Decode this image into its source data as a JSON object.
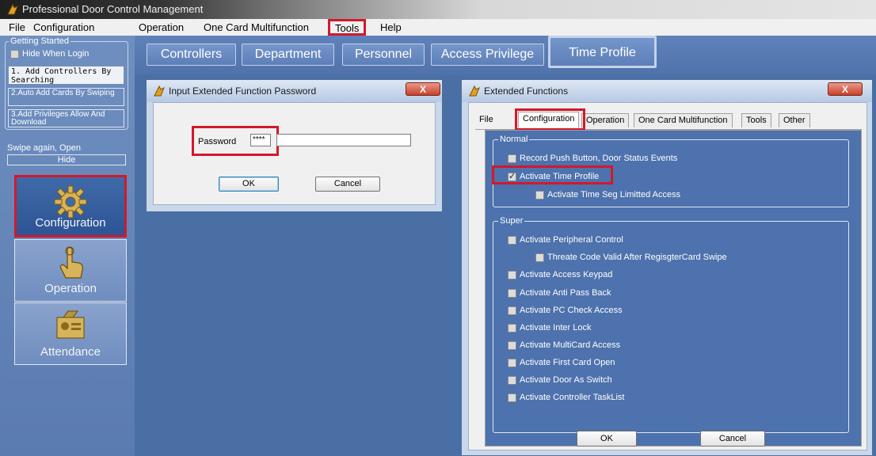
{
  "window": {
    "title": "Professional Door Control Management"
  },
  "menu": [
    "File",
    "Configuration",
    "Operation",
    "One Card Multifunction",
    "Tools",
    "Help"
  ],
  "getting_started": {
    "legend": "Getting Started",
    "hide_when_login": "Hide When Login",
    "step1": "1. Add Controllers By Searching",
    "step2": "2.Auto Add Cards By Swiping",
    "step3": "3.Add Privileges Allow And Download",
    "swipe_again": "Swipe again, Open",
    "hide_button": "Hide"
  },
  "nav": {
    "configuration": "Configuration",
    "operation": "Operation",
    "attendance": "Attendance"
  },
  "toolbar": {
    "controllers": "Controllers",
    "department": "Department",
    "personnel": "Personnel",
    "access_privilege": "Access Privilege",
    "time_profile": "Time Profile"
  },
  "password_dialog": {
    "title": "Input Extended Function Password",
    "label": "Password",
    "masked_value": "****",
    "ok": "OK",
    "cancel": "Cancel",
    "close": "X"
  },
  "ext_dialog": {
    "title": "Extended Functions",
    "close": "X",
    "tabs": [
      "File",
      "Configuration",
      "Operation",
      "One Card Multifunction",
      "Tools",
      "Other"
    ],
    "normal_legend": "Normal",
    "normal": [
      {
        "label": "Record Push Button, Door Status Events",
        "checked": false
      },
      {
        "label": "Activate Time Profile",
        "checked": true
      },
      {
        "label": "Activate Time Seg Limitted Access",
        "checked": false
      }
    ],
    "super_legend": "Super",
    "super": [
      {
        "label": "Activate Peripheral Control",
        "checked": false
      },
      {
        "label": "Threate Code Valid After RegisgterCard Swipe",
        "checked": false
      },
      {
        "label": "Activate Access Keypad",
        "checked": false
      },
      {
        "label": "Activate Anti Pass Back",
        "checked": false
      },
      {
        "label": "Activate PC Check Access",
        "checked": false
      },
      {
        "label": "Activate Inter Lock",
        "checked": false
      },
      {
        "label": "Activate MultiCard Access",
        "checked": false
      },
      {
        "label": "Activate First Card Open",
        "checked": false
      },
      {
        "label": "Activate Door As Switch",
        "checked": false
      },
      {
        "label": "Activate Controller TaskList",
        "checked": false
      }
    ],
    "ok": "OK",
    "cancel": "Cancel"
  },
  "colors": {
    "highlight": "#d3182b",
    "panel": "#5f82bb",
    "dialog": "#c9d7ea"
  }
}
